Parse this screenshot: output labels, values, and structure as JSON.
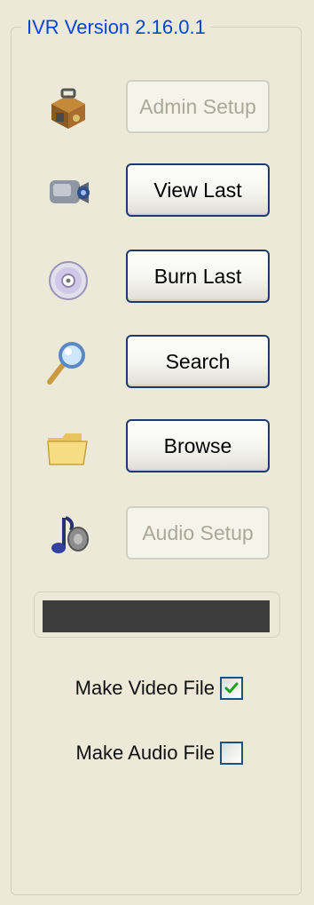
{
  "group": {
    "title": "IVR Version 2.16.0.1"
  },
  "buttons": {
    "admin_setup": {
      "label": "Admin Setup",
      "enabled": false
    },
    "view_last": {
      "label": "View Last",
      "enabled": true
    },
    "burn_last": {
      "label": "Burn Last",
      "enabled": true
    },
    "search": {
      "label": "Search",
      "enabled": true
    },
    "browse": {
      "label": "Browse",
      "enabled": true
    },
    "audio_setup": {
      "label": "Audio Setup",
      "enabled": false
    }
  },
  "icons": {
    "admin_setup": "toolbox-icon",
    "view_last": "video-camera-icon",
    "burn_last": "cd-disc-icon",
    "search": "magnifier-icon",
    "browse": "folder-icon",
    "audio_setup": "music-speaker-icon"
  },
  "checkboxes": {
    "make_video_file": {
      "label": "Make Video File",
      "checked": true
    },
    "make_audio_file": {
      "label": "Make Audio File",
      "checked": false
    }
  },
  "colors": {
    "background": "#ece9d8",
    "title": "#0046d5",
    "button_border": "#1c3a6e",
    "disabled_text": "#aca899",
    "progress_fill": "#3c3c3c",
    "check_mark": "#21a121"
  }
}
